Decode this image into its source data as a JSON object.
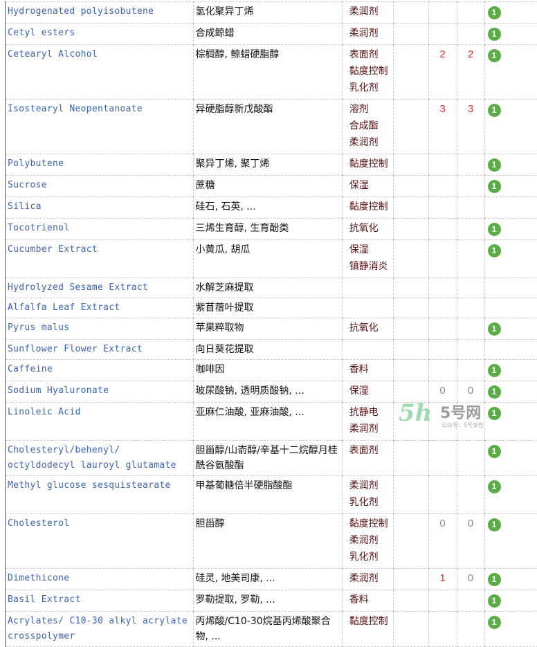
{
  "colors": {
    "name": "#3b64b4",
    "function": "#5a1010",
    "risk_red": "#e0302f",
    "risk_gray": "#888888",
    "badge": "#5aac44"
  },
  "rows": [
    {
      "name": "Hydrogenated polyisobutene",
      "cn": "氢化聚异丁烯",
      "funcs": [
        "柔润剂"
      ],
      "a": "",
      "b": "",
      "badge": "1"
    },
    {
      "name": "Cetyl esters",
      "cn": "合成鲸蜡",
      "funcs": [
        "柔润剂"
      ],
      "a": "",
      "b": "",
      "badge": "1"
    },
    {
      "name": "Cetearyl Alcohol",
      "cn": "棕榈醇, 鲸蜡硬脂醇",
      "funcs": [
        "表面剂",
        "黏度控制",
        "乳化剂"
      ],
      "a": "2",
      "b": "2",
      "badge": "1"
    },
    {
      "name": "Isostearyl Neopentanoate",
      "cn": "异硬脂醇新戊酸酯",
      "funcs": [
        "溶剂",
        "合成酯",
        "柔润剂"
      ],
      "a": "3",
      "b": "3",
      "badge": "1"
    },
    {
      "name": "Polybutene",
      "cn": "聚异丁烯, 聚丁烯",
      "funcs": [
        "黏度控制"
      ],
      "a": "",
      "b": "",
      "badge": "1"
    },
    {
      "name": "Sucrose",
      "cn": "蔗糖",
      "funcs": [
        "保湿"
      ],
      "a": "",
      "b": "",
      "badge": "1"
    },
    {
      "name": "Silica",
      "cn": "硅石, 石英, ...",
      "funcs": [
        "黏度控制"
      ],
      "a": "",
      "b": "",
      "badge": ""
    },
    {
      "name": "Tocotrienol",
      "cn": "三烯生育醇, 生育酚类",
      "funcs": [
        "抗氧化"
      ],
      "a": "",
      "b": "",
      "badge": "1"
    },
    {
      "name": "Cucumber Extract",
      "cn": "小黄瓜, 胡瓜",
      "funcs": [
        "保湿",
        "镇静消炎"
      ],
      "a": "",
      "b": "",
      "badge": "1"
    },
    {
      "name": "Hydrolyzed Sesame Extract",
      "cn": "水解芝麻提取",
      "funcs": [],
      "a": "",
      "b": "",
      "badge": ""
    },
    {
      "name": "Alfalfa Leaf Extract",
      "cn": "紫苜蓿叶提取",
      "funcs": [],
      "a": "",
      "b": "",
      "badge": ""
    },
    {
      "name": "Pyrus malus",
      "cn": "苹果粹取物",
      "funcs": [
        "抗氧化"
      ],
      "a": "",
      "b": "",
      "badge": "1"
    },
    {
      "name": "Sunflower Flower Extract",
      "cn": "向日葵花提取",
      "funcs": [],
      "a": "",
      "b": "",
      "badge": ""
    },
    {
      "name": "Caffeine",
      "cn": "咖啡因",
      "funcs": [
        "香料"
      ],
      "a": "",
      "b": "",
      "badge": "1"
    },
    {
      "name": "Sodium Hyaluronate",
      "cn": "玻尿酸钠, 透明质酸钠, ...",
      "funcs": [
        "保湿"
      ],
      "a": "0",
      "b": "0",
      "badge": "1"
    },
    {
      "name": "Linoleic Acid",
      "cn": "亚麻仁油酸, 亚麻油酸, ...",
      "funcs": [
        "抗静电",
        "柔润剂"
      ],
      "a": "",
      "b": "",
      "badge": "1"
    },
    {
      "name": "Cholesteryl/behenyl/ octyldodecyl lauroyl glutamate",
      "cn": "胆甾醇/山嵛醇/辛基十二烷醇月桂酰谷氨酸酯",
      "funcs": [
        "表面剂"
      ],
      "a": "",
      "b": "",
      "badge": "1"
    },
    {
      "name": "Methyl glucose sesquistearate",
      "cn": "甲基葡糖倍半硬脂酸酯",
      "funcs": [
        "柔润剂",
        "乳化剂"
      ],
      "a": "",
      "b": "",
      "badge": "1"
    },
    {
      "name": "Cholesterol",
      "cn": "胆甾醇",
      "funcs": [
        "黏度控制",
        "柔润剂",
        "乳化剂"
      ],
      "a": "0",
      "b": "0",
      "badge": "1"
    },
    {
      "name": "Dimethicone",
      "cn": "硅灵, 地美司康, ...",
      "funcs": [
        "柔润剂"
      ],
      "a": "1",
      "b": "0",
      "badge": "1"
    },
    {
      "name": "Basil Extract",
      "cn": "罗勒提取, 罗勒, ...",
      "funcs": [
        "香料"
      ],
      "a": "",
      "b": "",
      "badge": "1"
    },
    {
      "name": "Acrylates/ C10-30 alkyl acrylate crosspolymer",
      "cn": "丙烯酸/C10-30烷基丙烯酸聚合物, ...",
      "funcs": [
        "黏度控制"
      ],
      "a": "",
      "b": "",
      "badge": "1"
    }
  ],
  "watermark": {
    "logo": "5h",
    "title": "5号网",
    "subtitle": "公众号：5号女性"
  }
}
